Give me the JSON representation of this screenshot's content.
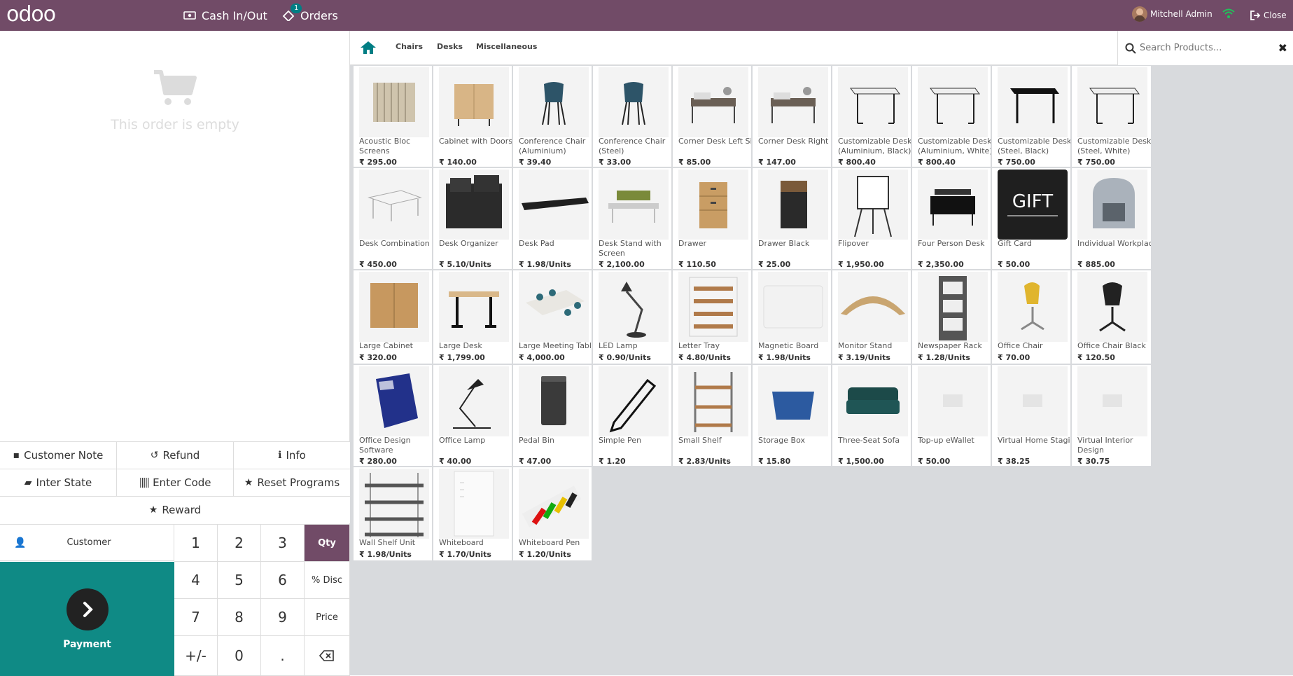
{
  "header": {
    "logo": "odoo",
    "cash_label": "Cash In/Out",
    "orders_label": "Orders",
    "orders_badge": "1",
    "user_name": "Mitchell Admin",
    "close_label": "Close",
    "brand_color": "#714b67",
    "wifi_color": "#21c15a"
  },
  "order": {
    "empty_text": "This order is empty"
  },
  "controls": {
    "customer_note": "Customer Note",
    "refund": "Refund",
    "info": "Info",
    "inter_state": "Inter State",
    "enter_code": "Enter Code",
    "reset_programs": "Reset Programs",
    "reward": "Reward"
  },
  "numpad": {
    "customer": "Customer",
    "payment": "Payment",
    "keys": [
      "1",
      "2",
      "3",
      "4",
      "5",
      "6",
      "7",
      "8",
      "9",
      "+/-",
      "0",
      "."
    ],
    "qty": "Qty",
    "disc": "% Disc",
    "price": "Price"
  },
  "categories": {
    "items": [
      "Chairs",
      "Desks",
      "Miscellaneous"
    ]
  },
  "search": {
    "placeholder": "Search Products..."
  },
  "products": [
    {
      "name": "Acoustic Bloc Screens",
      "price": "₹ 295.00",
      "icon": "screens"
    },
    {
      "name": "Cabinet with Doors",
      "price": "₹ 140.00",
      "icon": "cabinet"
    },
    {
      "name": "Conference Chair (Aluminium)",
      "price": "₹ 39.40",
      "icon": "chair-blue"
    },
    {
      "name": "Conference Chair (Steel)",
      "price": "₹ 33.00",
      "icon": "chair-blue"
    },
    {
      "name": "Corner Desk Left Sit",
      "price": "₹ 85.00",
      "icon": "corner-desk"
    },
    {
      "name": "Corner Desk Right Sit",
      "price": "₹ 147.00",
      "icon": "corner-desk"
    },
    {
      "name": "Customizable Desk (Aluminium, Black)",
      "price": "₹ 800.40",
      "icon": "desk-white"
    },
    {
      "name": "Customizable Desk (Aluminium, White)",
      "price": "₹ 800.40",
      "icon": "desk-white"
    },
    {
      "name": "Customizable Desk (Steel, Black)",
      "price": "₹ 750.00",
      "icon": "desk-black"
    },
    {
      "name": "Customizable Desk (Steel, White)",
      "price": "₹ 750.00",
      "icon": "desk-white"
    },
    {
      "name": "Desk Combination",
      "price": "₹ 450.00",
      "icon": "desk-combo"
    },
    {
      "name": "Desk Organizer",
      "price": "₹ 5.10/Units",
      "icon": "organizer"
    },
    {
      "name": "Desk Pad",
      "price": "₹ 1.98/Units",
      "icon": "deskpad"
    },
    {
      "name": "Desk Stand with Screen",
      "price": "₹ 2,100.00",
      "icon": "desk-stand"
    },
    {
      "name": "Drawer",
      "price": "₹ 110.50",
      "icon": "drawer"
    },
    {
      "name": "Drawer Black",
      "price": "₹ 25.00",
      "icon": "drawer-black"
    },
    {
      "name": "Flipover",
      "price": "₹ 1,950.00",
      "icon": "flipover"
    },
    {
      "name": "Four Person Desk",
      "price": "₹ 2,350.00",
      "icon": "four-desk"
    },
    {
      "name": "Gift Card",
      "price": "₹ 50.00",
      "icon": "gift"
    },
    {
      "name": "Individual Workplace",
      "price": "₹ 885.00",
      "icon": "workplace"
    },
    {
      "name": "Large Cabinet",
      "price": "₹ 320.00",
      "icon": "large-cabinet"
    },
    {
      "name": "Large Desk",
      "price": "₹ 1,799.00",
      "icon": "large-desk"
    },
    {
      "name": "Large Meeting Table",
      "price": "₹ 4,000.00",
      "icon": "meeting"
    },
    {
      "name": "LED Lamp",
      "price": "₹ 0.90/Units",
      "icon": "led-lamp"
    },
    {
      "name": "Letter Tray",
      "price": "₹ 4.80/Units",
      "icon": "letter-tray"
    },
    {
      "name": "Magnetic Board",
      "price": "₹ 1.98/Units",
      "icon": "mag-board"
    },
    {
      "name": "Monitor Stand",
      "price": "₹ 3.19/Units",
      "icon": "monitor-stand"
    },
    {
      "name": "Newspaper Rack",
      "price": "₹ 1.28/Units",
      "icon": "news-rack"
    },
    {
      "name": "Office Chair",
      "price": "₹ 70.00",
      "icon": "office-chair"
    },
    {
      "name": "Office Chair Black",
      "price": "₹ 120.50",
      "icon": "chair-black"
    },
    {
      "name": "Office Design Software",
      "price": "₹ 280.00",
      "icon": "software"
    },
    {
      "name": "Office Lamp",
      "price": "₹ 40.00",
      "icon": "office-lamp"
    },
    {
      "name": "Pedal Bin",
      "price": "₹ 47.00",
      "icon": "pedal-bin"
    },
    {
      "name": "Simple Pen",
      "price": "₹ 1.20",
      "icon": "pen"
    },
    {
      "name": "Small Shelf",
      "price": "₹ 2.83/Units",
      "icon": "small-shelf"
    },
    {
      "name": "Storage Box",
      "price": "₹ 15.80",
      "icon": "storage-box"
    },
    {
      "name": "Three-Seat Sofa",
      "price": "₹ 1,500.00",
      "icon": "sofa"
    },
    {
      "name": "Top-up eWallet",
      "price": "₹ 50.00",
      "icon": "placeholder"
    },
    {
      "name": "Virtual Home Staging",
      "price": "₹ 38.25",
      "icon": "placeholder"
    },
    {
      "name": "Virtual Interior Design",
      "price": "₹ 30.75",
      "icon": "placeholder"
    },
    {
      "name": "Wall Shelf Unit",
      "price": "₹ 1.98/Units",
      "icon": "wall-shelf"
    },
    {
      "name": "Whiteboard",
      "price": "₹ 1.70/Units",
      "icon": "whiteboard"
    },
    {
      "name": "Whiteboard Pen",
      "price": "₹ 1.20/Units",
      "icon": "wb-pen"
    }
  ]
}
